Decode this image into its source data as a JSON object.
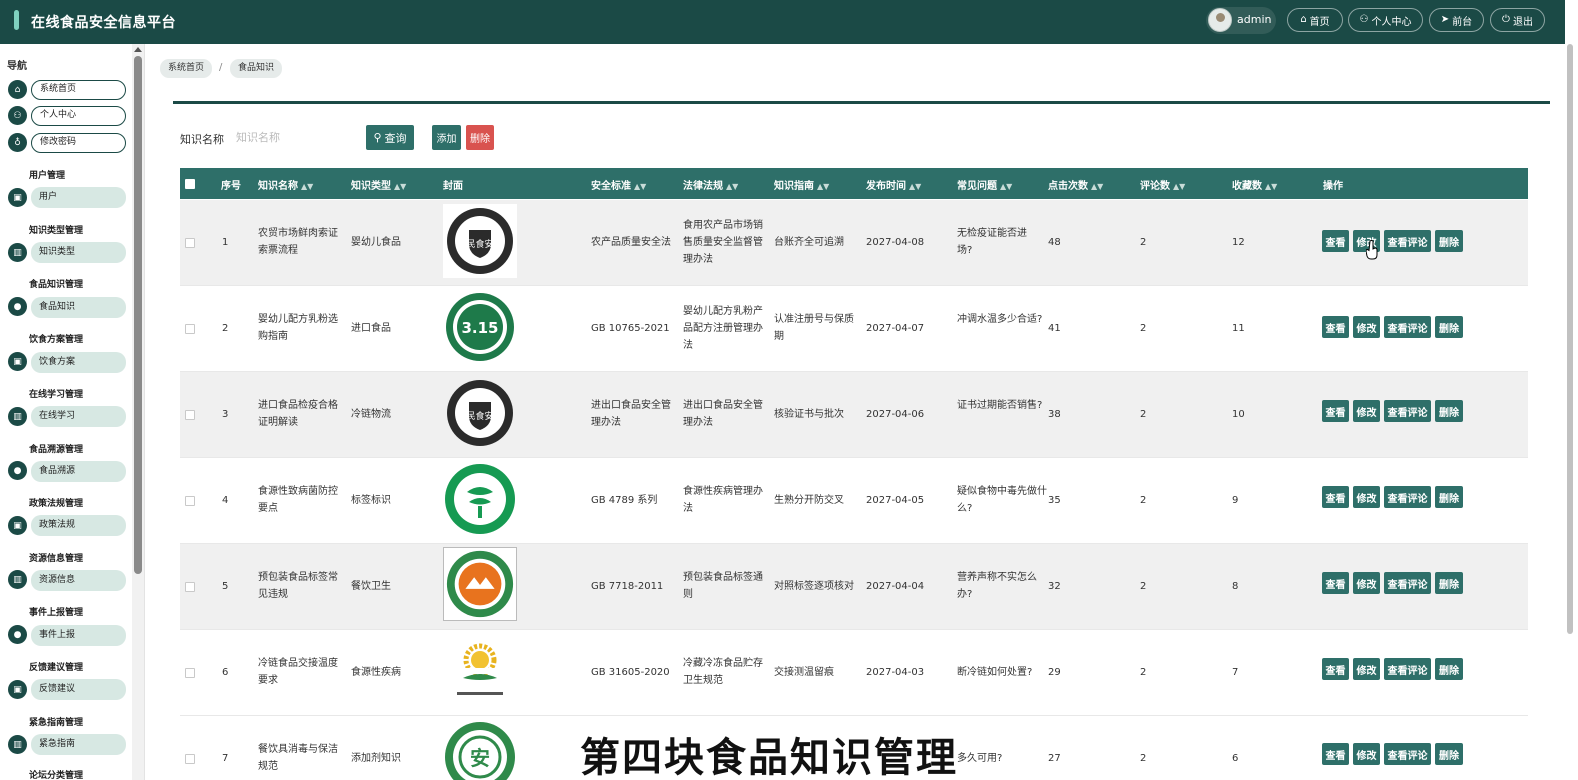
{
  "app": {
    "title": "在线食品安全信息平台",
    "user": "admin",
    "nav_buttons": [
      {
        "label": "首页",
        "icon": "home-icon"
      },
      {
        "label": "个人中心",
        "icon": "user-icon"
      },
      {
        "label": "前台",
        "icon": "send-icon"
      },
      {
        "label": "退出",
        "icon": "power-icon"
      }
    ]
  },
  "sidebar": {
    "title": "导航",
    "top_items": [
      {
        "label": "系统首页",
        "icon": "home-icon"
      },
      {
        "label": "个人中心",
        "icon": "user-icon"
      },
      {
        "label": "修改密码",
        "icon": "lock-icon"
      }
    ],
    "groups": [
      {
        "title": "用户管理",
        "item": "用户",
        "icon": "briefcase-icon"
      },
      {
        "title": "知识类型管理",
        "item": "知识类型",
        "icon": "chart-icon"
      },
      {
        "title": "食品知识管理",
        "item": "食品知识",
        "icon": "pin-icon"
      },
      {
        "title": "饮食方案管理",
        "item": "饮食方案",
        "icon": "briefcase-icon"
      },
      {
        "title": "在线学习管理",
        "item": "在线学习",
        "icon": "chart-icon"
      },
      {
        "title": "食品溯源管理",
        "item": "食品溯源",
        "icon": "pin-icon"
      },
      {
        "title": "政策法规管理",
        "item": "政策法规",
        "icon": "briefcase-icon"
      },
      {
        "title": "资源信息管理",
        "item": "资源信息",
        "icon": "chart-icon"
      },
      {
        "title": "事件上报管理",
        "item": "事件上报",
        "icon": "pin-icon"
      },
      {
        "title": "反馈建议管理",
        "item": "反馈建议",
        "icon": "briefcase-icon"
      },
      {
        "title": "紧急指南管理",
        "item": "紧急指南",
        "icon": "chart-icon"
      },
      {
        "title": "论坛分类管理",
        "item": "",
        "icon": ""
      }
    ]
  },
  "breadcrumb": [
    "系统首页",
    "食品知识"
  ],
  "breadcrumb_sep": "/",
  "search": {
    "label": "知识名称",
    "placeholder": "知识名称",
    "query_button": "查询",
    "add_button": "添加",
    "delete_button": "删除"
  },
  "table": {
    "columns": [
      "序号",
      "知识名称",
      "知识类型",
      "封面",
      "安全标准",
      "法律法规",
      "知识指南",
      "发布时间",
      "常见问题",
      "点击次数",
      "评论数",
      "收藏数",
      "操作"
    ],
    "actions": [
      "查看",
      "修改",
      "查看评论",
      "删除"
    ],
    "rows": [
      {
        "no": "1",
        "name": "农贸市场鲜肉索证索票流程",
        "type": "婴幼儿食品",
        "cover": "民食安徽标",
        "standard": "农产品质量安全法",
        "law": "食用农产品市场销售质量安全监督管理办法",
        "guide": "台账齐全可追溯",
        "date": "2027-04-08",
        "faq": "无检疫证能否进场?",
        "clicks": "48",
        "comments": "2",
        "favs": "12"
      },
      {
        "no": "2",
        "name": "婴幼儿配方乳粉选购指南",
        "type": "进口食品",
        "cover": "3.15徽标",
        "standard": "GB 10765-2021",
        "law": "婴幼儿配方乳粉产品配方注册管理办法",
        "guide": "认准注册号与保质期",
        "date": "2027-04-07",
        "faq": "冲调水温多少合适?",
        "clicks": "41",
        "comments": "2",
        "favs": "11"
      },
      {
        "no": "3",
        "name": "进口食品检疫合格证明解读",
        "type": "冷链物流",
        "cover": "民食安徽标",
        "standard": "进出口食品安全管理办法",
        "law": "进出口食品安全管理办法",
        "guide": "核验证书与批次",
        "date": "2027-04-06",
        "faq": "证书过期能否销售?",
        "clicks": "38",
        "comments": "2",
        "favs": "10"
      },
      {
        "no": "4",
        "name": "食源性致病菌防控要点",
        "type": "标签标识",
        "cover": "绿色徽标",
        "standard": "GB 4789 系列",
        "law": "食源性疾病管理办法",
        "guide": "生熟分开防交叉",
        "date": "2027-04-05",
        "faq": "疑似食物中毒先做什么?",
        "clicks": "35",
        "comments": "2",
        "favs": "9"
      },
      {
        "no": "5",
        "name": "预包装食品标签常见违规",
        "type": "餐饮卫生",
        "cover": "橙色徽标",
        "standard": "GB 7718-2011",
        "law": "预包装食品标签通则",
        "guide": "对照标签逐项核对",
        "date": "2027-04-04",
        "faq": "营养声称不实怎么办?",
        "clicks": "32",
        "comments": "2",
        "favs": "8"
      },
      {
        "no": "6",
        "name": "冷链食品交接温度要求",
        "type": "食源性疾病",
        "cover": "日出徽标",
        "standard": "GB 31605-2020",
        "law": "冷藏冷冻食品贮存卫生规范",
        "guide": "交接测温留痕",
        "date": "2027-04-03",
        "faq": "断冷链如何处置?",
        "clicks": "29",
        "comments": "2",
        "favs": "7"
      },
      {
        "no": "7",
        "name": "餐饮具消毒与保洁规范",
        "type": "添加剂知识",
        "cover": "安字徽标",
        "standard": "",
        "law": "",
        "guide": "",
        "date": "",
        "faq": "多久可用?",
        "clicks": "27",
        "comments": "2",
        "favs": "6"
      }
    ]
  },
  "overlay_caption": "第四块食品知识管理",
  "colors": {
    "primary": "#1b4a46",
    "button": "#2e6f69",
    "danger": "#d9534f",
    "menu_fill": "#d7e8e3"
  }
}
